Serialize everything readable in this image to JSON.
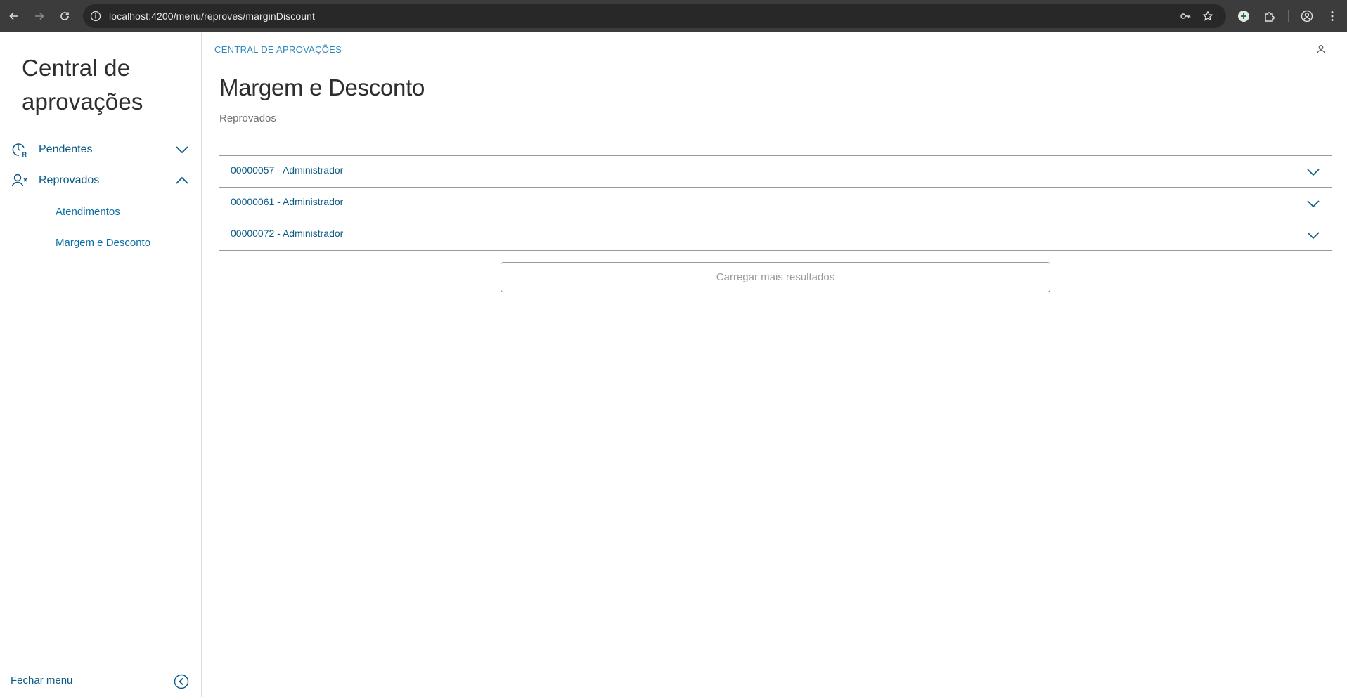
{
  "browser": {
    "url": "localhost:4200/menu/reproves/marginDiscount"
  },
  "sidebar": {
    "app_title": "Central de aprovações",
    "items": [
      {
        "label": "Pendentes",
        "icon": "clock-r-icon",
        "expanded": false
      },
      {
        "label": "Reprovados",
        "icon": "user-x-icon",
        "expanded": true
      }
    ],
    "sub_items": [
      {
        "label": "Atendimentos"
      },
      {
        "label": "Margem e Desconto"
      }
    ],
    "footer_label": "Fechar menu"
  },
  "topbar": {
    "breadcrumb": "CENTRAL DE APROVAÇÕES"
  },
  "main": {
    "title": "Margem e Desconto",
    "subtitle": "Reprovados",
    "rows": [
      {
        "label": "00000057 - Administrador"
      },
      {
        "label": "00000061 - Administrador"
      },
      {
        "label": "00000072 - Administrador"
      }
    ],
    "load_more_label": "Carregar mais resultados"
  },
  "colors": {
    "accent": "#0c5a86",
    "link": "#0c6fa8",
    "chrome_bg": "#3c3c3c",
    "border": "#9a9a9a"
  }
}
